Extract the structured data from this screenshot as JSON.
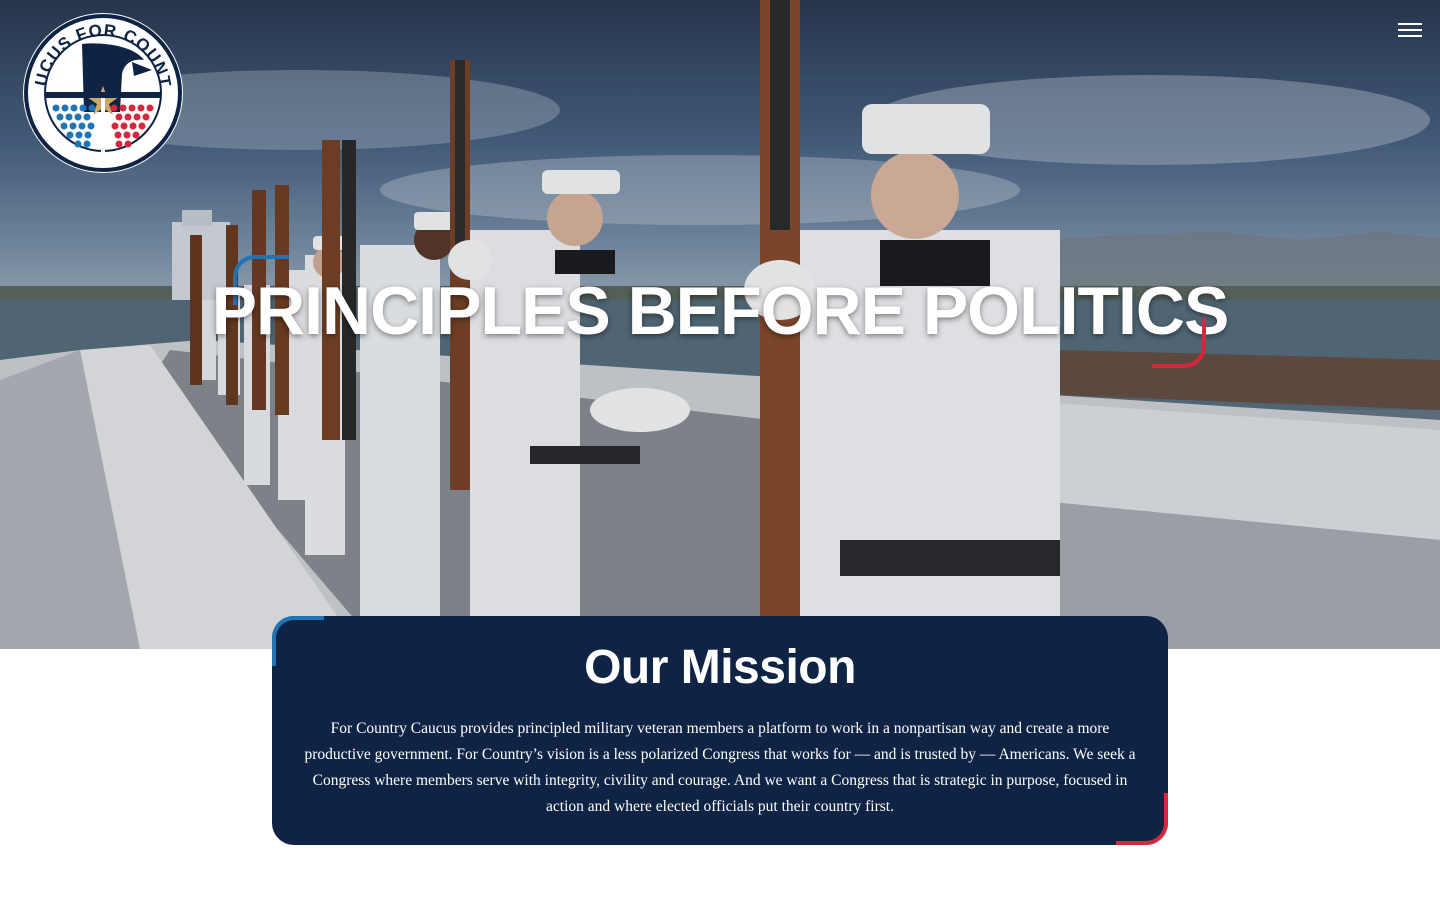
{
  "site": {
    "logo_text": "CAUCUS FOR COUNTRY",
    "menu_icon": "hamburger-menu-icon"
  },
  "hero": {
    "title": "PRINCIPLES BEFORE POLITICS",
    "image_subject": "hero-photo"
  },
  "mission": {
    "heading": "Our Mission",
    "body": "For Country Caucus provides principled military veteran members a platform to work in a nonpartisan way and create a more productive government. For Country’s vision is a less polarized Congress that works for — and is trusted by — Americans. We seek a Congress where members serve with integrity, civility and courage. And we want a Congress that is strategic in purpose, focused in action and where elected officials put their country first."
  },
  "colors": {
    "navy": "#0f2444",
    "accent_blue": "#1e74b5",
    "accent_red": "#d22a3c",
    "white": "#ffffff"
  }
}
